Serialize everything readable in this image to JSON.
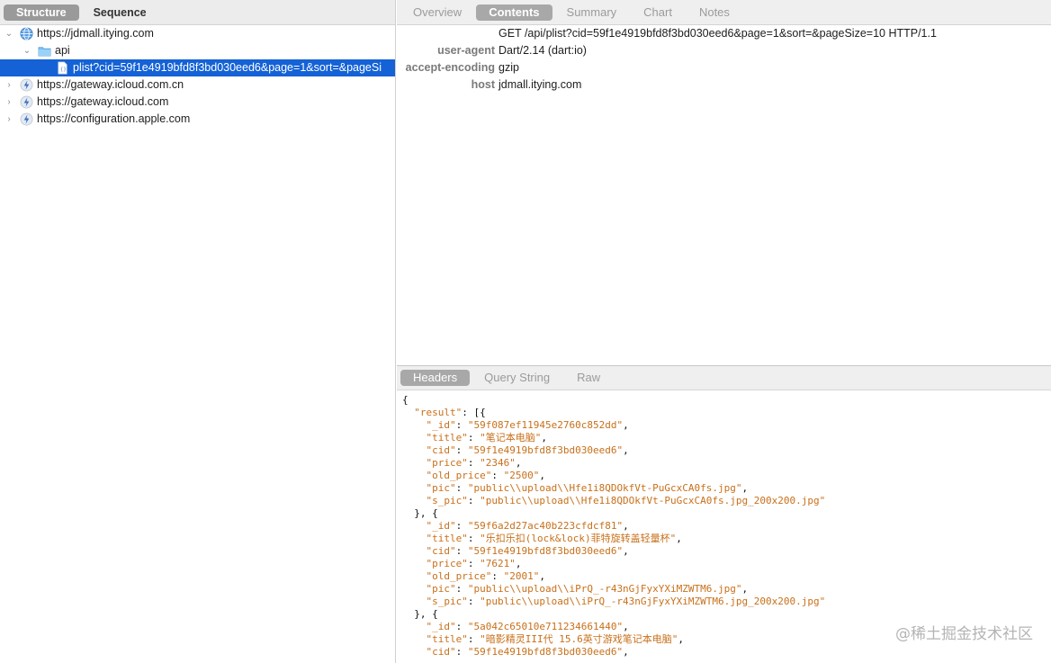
{
  "left": {
    "tabs": [
      {
        "label": "Structure",
        "active": true
      },
      {
        "label": "Sequence",
        "active": false
      }
    ],
    "tree": [
      {
        "label": "https://jdmall.itying.com",
        "expanded": true,
        "icon": "globe-icon"
      },
      {
        "label": "api",
        "expanded": true,
        "icon": "folder-icon"
      },
      {
        "label": "plist?cid=59f1e4919bfd8f3bd030eed6&page=1&sort=&pageSi",
        "icon": "file-icon",
        "selected": true
      },
      {
        "label": "https://gateway.icloud.com.cn",
        "expanded": false,
        "icon": "bolt-icon"
      },
      {
        "label": "https://gateway.icloud.com",
        "expanded": false,
        "icon": "bolt-icon"
      },
      {
        "label": "https://configuration.apple.com",
        "expanded": false,
        "icon": "bolt-icon"
      }
    ]
  },
  "right": {
    "tabs": [
      {
        "label": "Overview",
        "active": false
      },
      {
        "label": "Contents",
        "active": true
      },
      {
        "label": "Summary",
        "active": false
      },
      {
        "label": "Chart",
        "active": false
      },
      {
        "label": "Notes",
        "active": false
      }
    ],
    "request_line": "GET /api/plist?cid=59f1e4919bfd8f3bd030eed6&page=1&sort=&pageSize=10 HTTP/1.1",
    "headers": [
      {
        "key": "user-agent",
        "value": "Dart/2.14 (dart:io)"
      },
      {
        "key": "accept-encoding",
        "value": "gzip"
      },
      {
        "key": "host",
        "value": "jdmall.itying.com"
      }
    ],
    "subtabs": [
      {
        "label": "Headers",
        "active": true
      },
      {
        "label": "Query String",
        "active": false
      },
      {
        "label": "Raw",
        "active": false
      }
    ],
    "json_lines": [
      {
        "indent": "",
        "text": "{"
      },
      {
        "indent": "  ",
        "key": "\"result\"",
        "rest": ": [{"
      },
      {
        "indent": "    ",
        "key": "\"_id\"",
        "sep": ": ",
        "str": "\"59f087ef11945e2760c852dd\"",
        "tail": ","
      },
      {
        "indent": "    ",
        "key": "\"title\"",
        "sep": ": ",
        "str": "\"笔记本电脑\"",
        "tail": ","
      },
      {
        "indent": "    ",
        "key": "\"cid\"",
        "sep": ": ",
        "str": "\"59f1e4919bfd8f3bd030eed6\"",
        "tail": ","
      },
      {
        "indent": "    ",
        "key": "\"price\"",
        "sep": ": ",
        "str": "\"2346\"",
        "tail": ","
      },
      {
        "indent": "    ",
        "key": "\"old_price\"",
        "sep": ": ",
        "str": "\"2500\"",
        "tail": ","
      },
      {
        "indent": "    ",
        "key": "\"pic\"",
        "sep": ": ",
        "str": "\"public\\\\upload\\\\Hfe1i8QDOkfVt-PuGcxCA0fs.jpg\"",
        "tail": ","
      },
      {
        "indent": "    ",
        "key": "\"s_pic\"",
        "sep": ": ",
        "str": "\"public\\\\upload\\\\Hfe1i8QDOkfVt-PuGcxCA0fs.jpg_200x200.jpg\"",
        "tail": ""
      },
      {
        "indent": "  ",
        "text": "}, {"
      },
      {
        "indent": "    ",
        "key": "\"_id\"",
        "sep": ": ",
        "str": "\"59f6a2d27ac40b223cfdcf81\"",
        "tail": ","
      },
      {
        "indent": "    ",
        "key": "\"title\"",
        "sep": ": ",
        "str": "\"乐扣乐扣(lock&lock)菲特旋转盖轻量杯\"",
        "tail": ","
      },
      {
        "indent": "    ",
        "key": "\"cid\"",
        "sep": ": ",
        "str": "\"59f1e4919bfd8f3bd030eed6\"",
        "tail": ","
      },
      {
        "indent": "    ",
        "key": "\"price\"",
        "sep": ": ",
        "str": "\"7621\"",
        "tail": ","
      },
      {
        "indent": "    ",
        "key": "\"old_price\"",
        "sep": ": ",
        "str": "\"2001\"",
        "tail": ","
      },
      {
        "indent": "    ",
        "key": "\"pic\"",
        "sep": ": ",
        "str": "\"public\\\\upload\\\\iPrQ_-r43nGjFyxYXiMZWTM6.jpg\"",
        "tail": ","
      },
      {
        "indent": "    ",
        "key": "\"s_pic\"",
        "sep": ": ",
        "str": "\"public\\\\upload\\\\iPrQ_-r43nGjFyxYXiMZWTM6.jpg_200x200.jpg\"",
        "tail": ""
      },
      {
        "indent": "  ",
        "text": "}, {"
      },
      {
        "indent": "    ",
        "key": "\"_id\"",
        "sep": ": ",
        "str": "\"5a042c65010e711234661440\"",
        "tail": ","
      },
      {
        "indent": "    ",
        "key": "\"title\"",
        "sep": ": ",
        "str": "\"暗影精灵III代 15.6英寸游戏笔记本电脑\"",
        "tail": ","
      },
      {
        "indent": "    ",
        "key": "\"cid\"",
        "sep": ": ",
        "str": "\"59f1e4919bfd8f3bd030eed6\"",
        "tail": ","
      }
    ]
  },
  "watermark": "@稀土掘金技术社区"
}
